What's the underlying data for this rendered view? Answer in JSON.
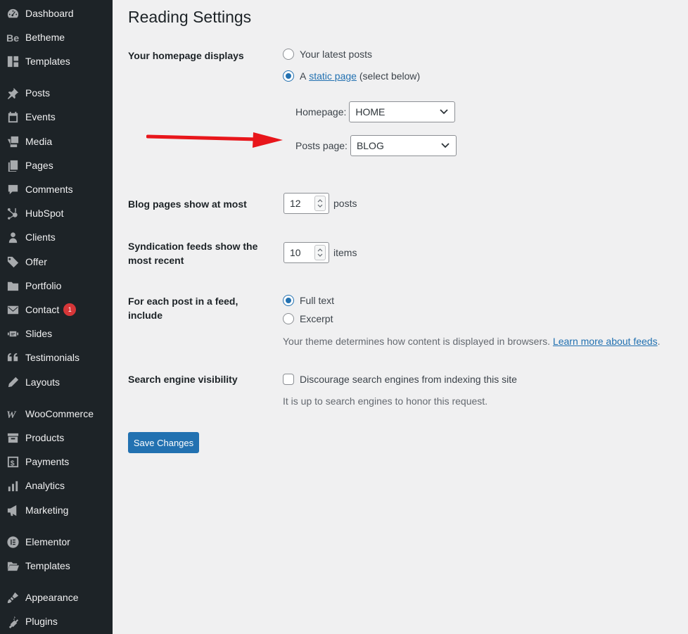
{
  "sidebar": {
    "items": [
      {
        "label": "Dashboard",
        "icon": "dashboard-icon"
      },
      {
        "label": "Betheme",
        "icon": "betheme-icon"
      },
      {
        "label": "Templates",
        "icon": "templates-icon"
      },
      {
        "label": "Posts",
        "icon": "pushpin-icon"
      },
      {
        "label": "Events",
        "icon": "calendar-icon"
      },
      {
        "label": "Media",
        "icon": "media-icon"
      },
      {
        "label": "Pages",
        "icon": "pages-icon"
      },
      {
        "label": "Comments",
        "icon": "comment-icon"
      },
      {
        "label": "HubSpot",
        "icon": "hubspot-icon"
      },
      {
        "label": "Clients",
        "icon": "person-icon"
      },
      {
        "label": "Offer",
        "icon": "tag-icon"
      },
      {
        "label": "Portfolio",
        "icon": "folder-icon"
      },
      {
        "label": "Contact",
        "icon": "mail-icon",
        "badge": "1"
      },
      {
        "label": "Slides",
        "icon": "slides-icon"
      },
      {
        "label": "Testimonials",
        "icon": "quote-icon"
      },
      {
        "label": "Layouts",
        "icon": "pencil-icon"
      },
      {
        "label": "WooCommerce",
        "icon": "woocommerce-icon"
      },
      {
        "label": "Products",
        "icon": "archive-icon"
      },
      {
        "label": "Payments",
        "icon": "dollar-icon"
      },
      {
        "label": "Analytics",
        "icon": "bar-chart-icon"
      },
      {
        "label": "Marketing",
        "icon": "megaphone-icon"
      },
      {
        "label": "Elementor",
        "icon": "elementor-icon"
      },
      {
        "label": "Templates",
        "icon": "folder-open-icon"
      },
      {
        "label": "Appearance",
        "icon": "paintbrush-icon"
      },
      {
        "label": "Plugins",
        "icon": "plugin-icon"
      }
    ]
  },
  "page": {
    "title": "Reading Settings"
  },
  "homepage_displays": {
    "label": "Your homepage displays",
    "option_latest": "Your latest posts",
    "option_static_prefix": "A",
    "option_static_link": "static page",
    "option_static_suffix": "(select below)",
    "homepage_label": "Homepage:",
    "homepage_value": "HOME",
    "posts_page_label": "Posts page:",
    "posts_page_value": "BLOG"
  },
  "blog_pages": {
    "label": "Blog pages show at most",
    "value": "12",
    "unit": "posts"
  },
  "syndication": {
    "label": "Syndication feeds show the most recent",
    "value": "10",
    "unit": "items"
  },
  "feed_include": {
    "label": "For each post in a feed, include",
    "option_full": "Full text",
    "option_excerpt": "Excerpt",
    "description": "Your theme determines how content is displayed in browsers.",
    "description_link": "Learn more about feeds",
    "description_end": "."
  },
  "search_visibility": {
    "label": "Search engine visibility",
    "checkbox_label": "Discourage search engines from indexing this site",
    "description": "It is up to search engines to honor this request."
  },
  "actions": {
    "save_label": "Save Changes"
  },
  "colors": {
    "accent": "#2271b1",
    "sidebar_bg": "#1d2327",
    "badge": "#d63638",
    "arrow": "#e8161b"
  }
}
